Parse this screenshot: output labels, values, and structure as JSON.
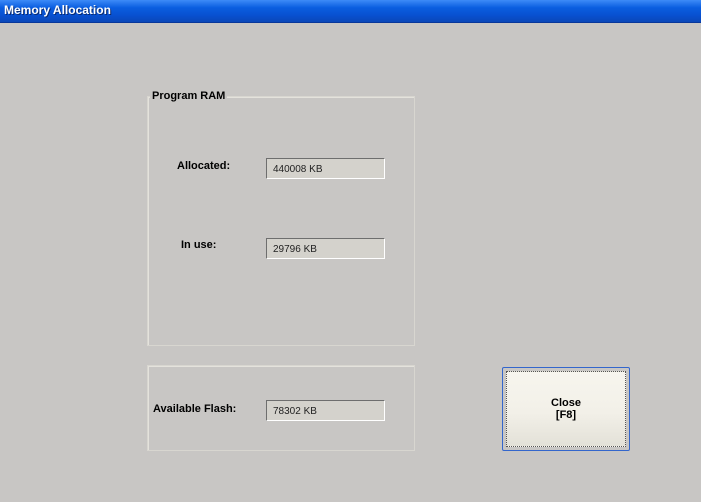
{
  "window": {
    "title": "Memory Allocation"
  },
  "program_ram": {
    "legend": "Program RAM",
    "allocated_label": "Allocated:",
    "allocated_value": "440008 KB",
    "in_use_label": "In use:",
    "in_use_value": "29796 KB"
  },
  "flash": {
    "label": "Available Flash:",
    "value": "78302 KB"
  },
  "close_button": {
    "line1": "Close",
    "line2": "[F8]"
  },
  "colors": {
    "titlebar": "#0a5ee0",
    "background": "#c8c6c4",
    "button_border": "#3366cc"
  }
}
